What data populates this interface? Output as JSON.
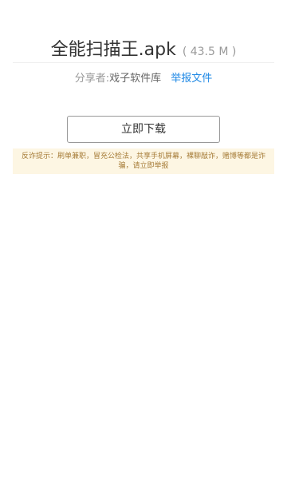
{
  "file": {
    "name": "全能扫描王.apk",
    "size": "( 43.5 M )"
  },
  "share": {
    "label": "分享者:",
    "name": "戏子软件库",
    "report_label": "举报文件"
  },
  "download": {
    "label": "立即下载"
  },
  "warning": {
    "text": "反诈提示：刷单兼职，冒充公检法，共享手机屏幕，裸聊敲诈，赌博等都是诈骗，请立即举报"
  },
  "colors": {
    "link": "#1e88e5",
    "warning_bg": "#fdf6e3",
    "warning_text": "#a67c38"
  }
}
